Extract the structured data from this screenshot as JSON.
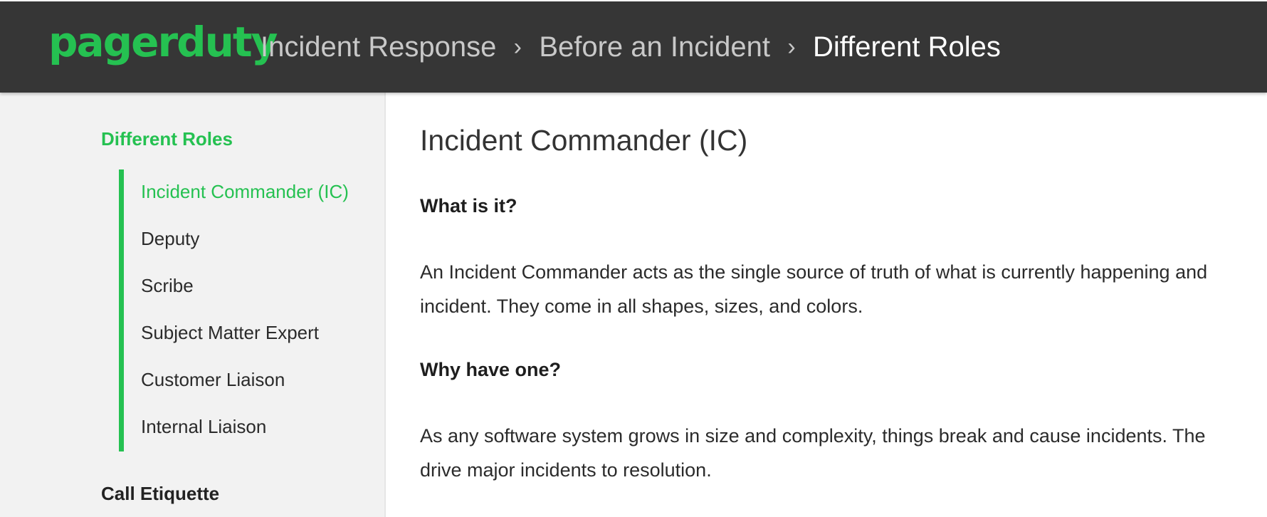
{
  "header": {
    "logo_text": "pagerduty",
    "breadcrumbs": [
      "Incident Response",
      "Before an Incident",
      "Different Roles"
    ],
    "separator_icon": "chevron-right-icon",
    "background_color": "#363636",
    "brand_color": "#25c151"
  },
  "sidebar": {
    "section_title": "Different Roles",
    "items": [
      "Incident Commander (IC)",
      "Deputy",
      "Scribe",
      "Subject Matter Expert",
      "Customer Liaison",
      "Internal Liaison"
    ],
    "active_index": 0,
    "next_section_title": "Call Etiquette"
  },
  "main": {
    "title": "Incident Commander (IC)",
    "sections": [
      {
        "heading": "What is it?",
        "paragraph_lines": [
          "An Incident Commander acts as the single source of truth of what is currently happening and",
          "incident. They come in all shapes, sizes, and colors."
        ]
      },
      {
        "heading": "Why have one?",
        "paragraph_lines": [
          "As any software system grows in size and complexity, things break and cause incidents. The",
          "drive major incidents to resolution."
        ]
      }
    ]
  }
}
